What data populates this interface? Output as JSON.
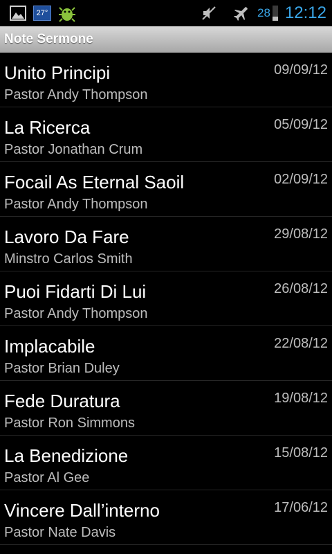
{
  "status_bar": {
    "temperature": "27°",
    "battery_percent": "28",
    "battery_level": 0.28,
    "time": "12:12",
    "icons": [
      "gallery-icon",
      "weather-temp-icon",
      "android-debug-icon",
      "mute-icon",
      "airplane-mode-icon",
      "battery-icon"
    ]
  },
  "app": {
    "title": "Note Sermone"
  },
  "sermons": [
    {
      "title": "Unito Principi",
      "speaker": "Pastor Andy Thompson",
      "date": "09/09/12"
    },
    {
      "title": "La Ricerca",
      "speaker": "Pastor Jonathan Crum",
      "date": "05/09/12"
    },
    {
      "title": "Focail As Eternal Saoil",
      "speaker": "Pastor Andy Thompson",
      "date": "02/09/12"
    },
    {
      "title": "Lavoro Da Fare",
      "speaker": "Minstro Carlos Smith",
      "date": "29/08/12"
    },
    {
      "title": "Puoi Fidarti Di Lui",
      "speaker": "Pastor Andy Thompson",
      "date": "26/08/12"
    },
    {
      "title": "Implacabile",
      "speaker": "Pastor Brian Duley",
      "date": "22/08/12"
    },
    {
      "title": "Fede Duratura",
      "speaker": "Pastor Ron Simmons",
      "date": "19/08/12"
    },
    {
      "title": "La Benedizione",
      "speaker": "Pastor Al Gee",
      "date": "15/08/12"
    },
    {
      "title": "Vincere Dall’interno",
      "speaker": "Pastor Nate Davis",
      "date": "17/06/12"
    }
  ]
}
